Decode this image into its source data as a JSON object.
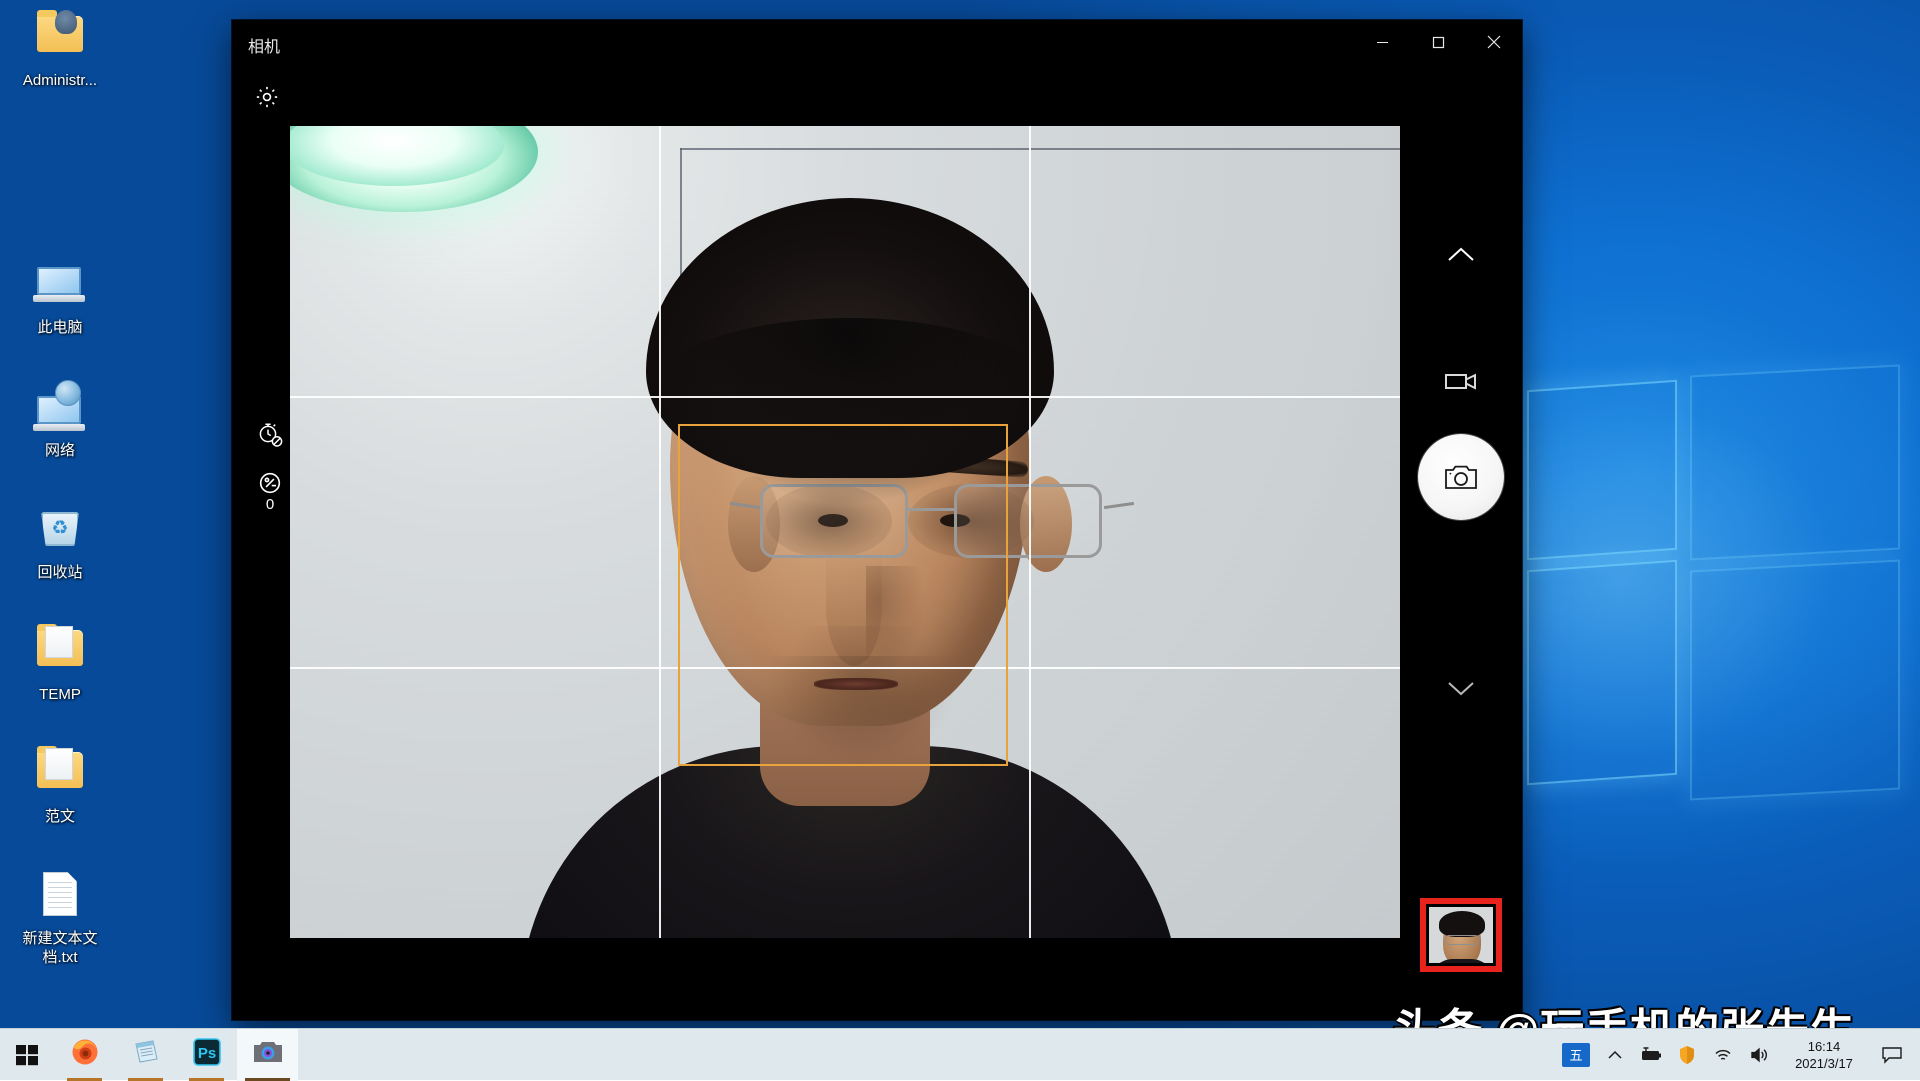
{
  "desktop": {
    "icons": [
      {
        "label": "Administr...",
        "type": "user-folder-icon"
      },
      {
        "label": "此电脑",
        "type": "this-pc-icon"
      },
      {
        "label": "网络",
        "type": "network-icon"
      },
      {
        "label": "回收站",
        "type": "recycle-bin-icon"
      },
      {
        "label": "TEMP",
        "type": "folder-icon"
      },
      {
        "label": "范文",
        "type": "folder-icon"
      },
      {
        "label": "新建文本文档.txt",
        "type": "text-file-icon"
      }
    ]
  },
  "camera_window": {
    "title": "相机",
    "controls": {
      "minimize": "—",
      "maximize": "☐",
      "close": "✕"
    },
    "settings_label": "设置",
    "timer_label": "自拍定时器 关闭",
    "exposure_label": "曝光补偿",
    "exposure_value": "0",
    "right_rail": {
      "scroll_up": "⌃",
      "video_mode": "录像模式",
      "shutter": "拍照",
      "scroll_down": "⌄"
    },
    "viewfinder": {
      "grid_enabled": true,
      "grid_type": "rule-of-thirds",
      "face_box_color": "#e8a33d",
      "face_detected": true,
      "gallery_thumbnail_highlight_color": "#e8221d"
    }
  },
  "watermark": {
    "text": "头条 @玩手机的张先生"
  },
  "taskbar": {
    "start_label": "开始",
    "apps": [
      {
        "name": "firefox-icon",
        "label": "Firefox",
        "state": "open"
      },
      {
        "name": "notepad-icon",
        "label": "记事本",
        "state": "open"
      },
      {
        "name": "photoshop-icon",
        "label": "Ps",
        "state": "open"
      },
      {
        "name": "camera-icon",
        "label": "相机",
        "state": "active"
      }
    ],
    "tray": {
      "ime": "五",
      "show_hidden": "⌃",
      "battery": "电池",
      "security": "安全",
      "network": "网络",
      "volume": "音量",
      "time": "16:14",
      "date": "2021/3/17",
      "notifications": "通知"
    }
  },
  "colors": {
    "desktop_blue": "#0d7ad8",
    "taskbar": "#dfe8ed",
    "window_black": "#000000",
    "accent_orange": "#e8a33d",
    "highlight_red": "#e8221d"
  }
}
